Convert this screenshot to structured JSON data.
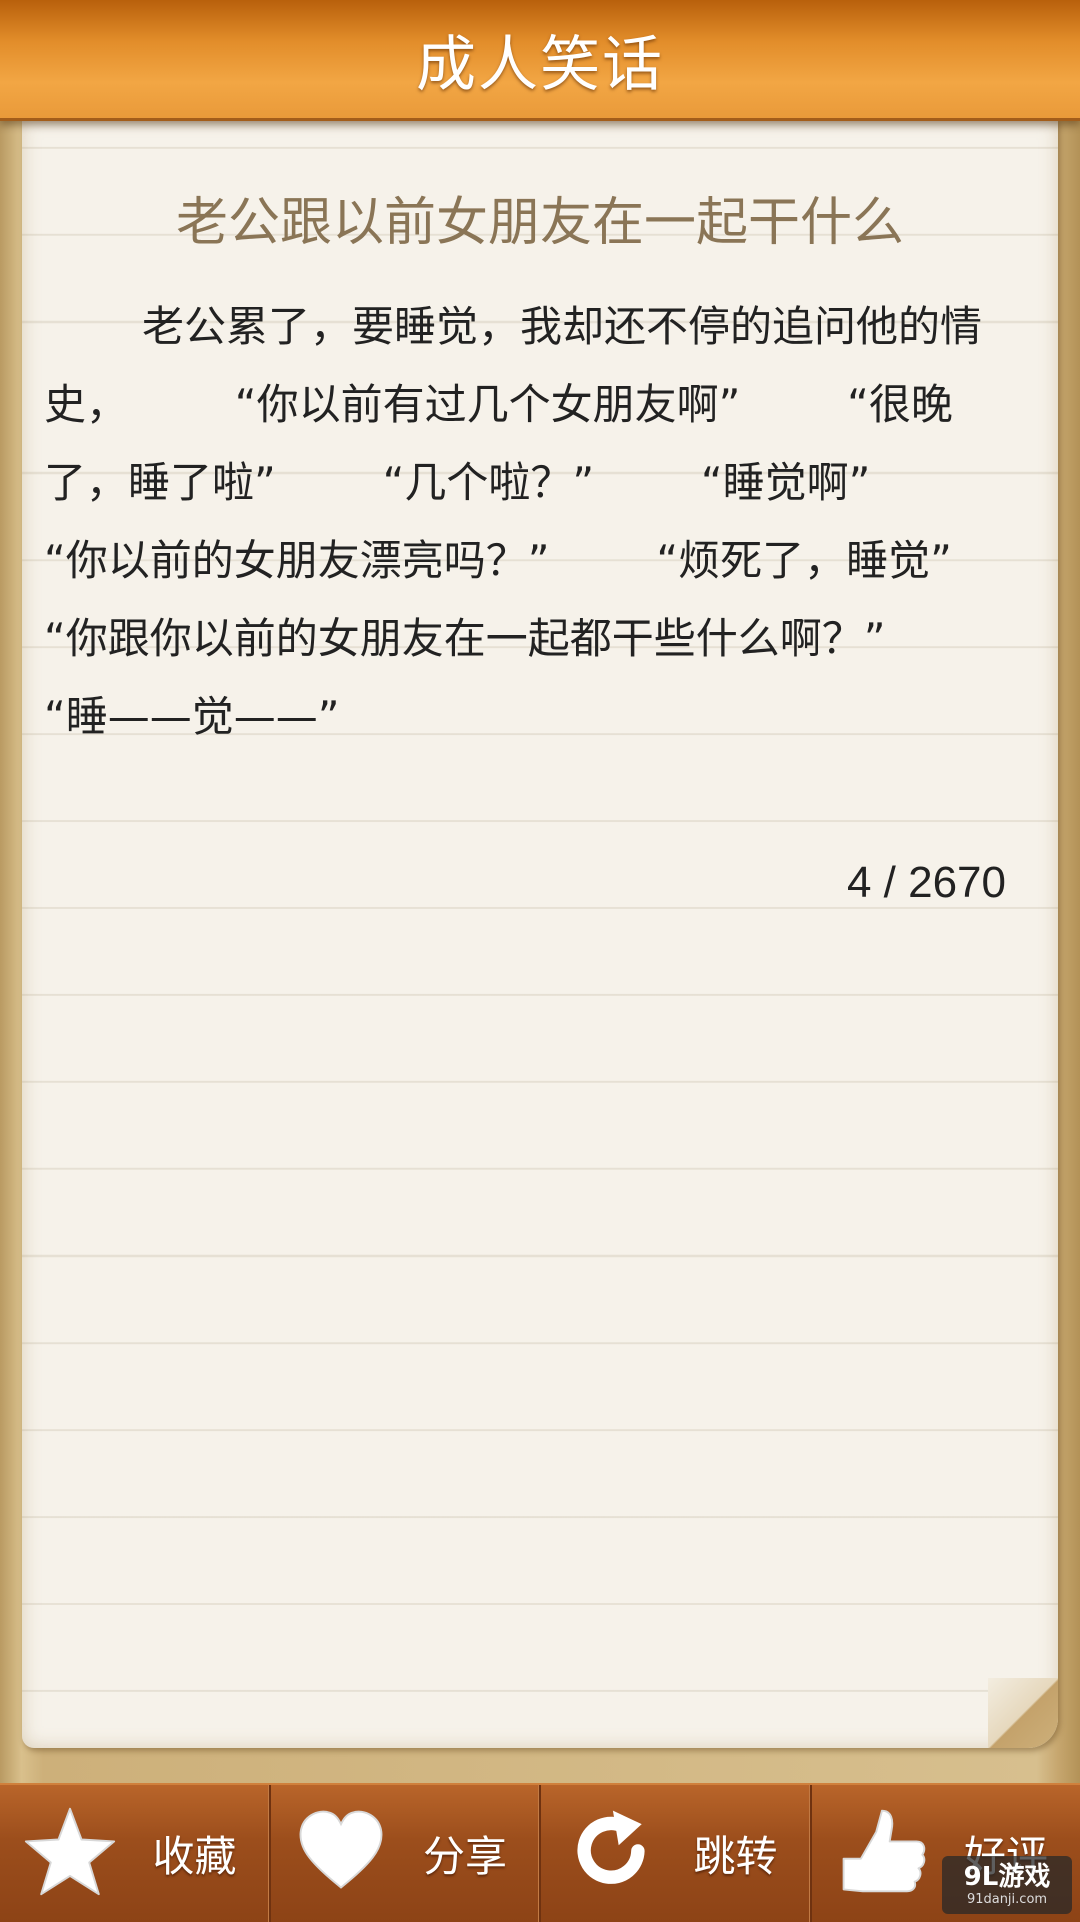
{
  "header": {
    "title": "成人笑话"
  },
  "joke": {
    "title": "老公跟以前女朋友在一起干什么",
    "body": "老公累了，要睡觉，我却还不停的追问他的情史，        “你以前有过几个女朋友啊”        “很晚了，睡了啦”        “几个啦？”        “睡觉啊”        “你以前的女朋友漂亮吗？”        “烦死了，睡觉”        “你跟你以前的女朋友在一起都干些什么啊？”        “睡——觉——”",
    "page_counter": "4 / 2670"
  },
  "toolbar": {
    "buttons": [
      {
        "label": "收藏",
        "icon": "star-icon"
      },
      {
        "label": "分享",
        "icon": "heart-icon"
      },
      {
        "label": "跳转",
        "icon": "refresh-icon"
      },
      {
        "label": "好评",
        "icon": "thumbs-up-icon"
      }
    ]
  },
  "watermark": {
    "main": "9L游戏",
    "sub": "91danji.com"
  },
  "colors": {
    "header": "#e28d2a",
    "toolbar": "#9c4e1c",
    "paper": "#f6f2ea",
    "title_text": "#8a7556"
  }
}
